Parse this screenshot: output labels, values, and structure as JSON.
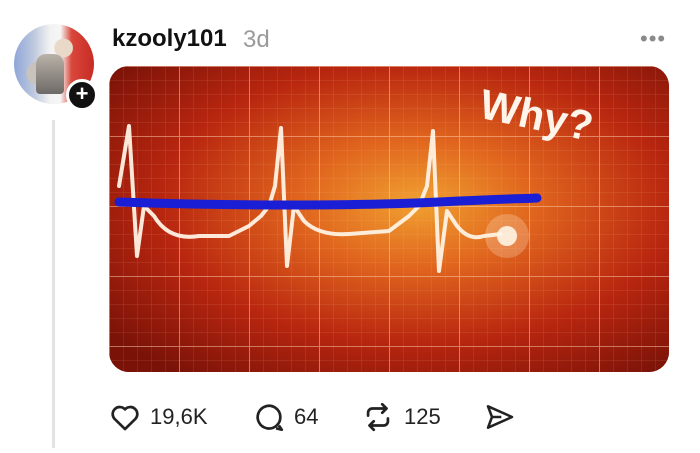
{
  "post": {
    "username": "kzooly101",
    "timestamp": "3d",
    "more_label": "•••",
    "image_caption_text": "Why?"
  },
  "actions": {
    "likes": "19,6K",
    "replies": "64",
    "reposts": "125"
  },
  "icons": {
    "like": "heart-icon",
    "reply": "speech-bubble-icon",
    "repost": "repost-icon",
    "share": "send-icon",
    "follow": "plus-icon"
  },
  "colors": {
    "text_primary": "#111111",
    "text_secondary": "#9a9a9a",
    "ecg_overlay_line": "#1a1fd6"
  }
}
